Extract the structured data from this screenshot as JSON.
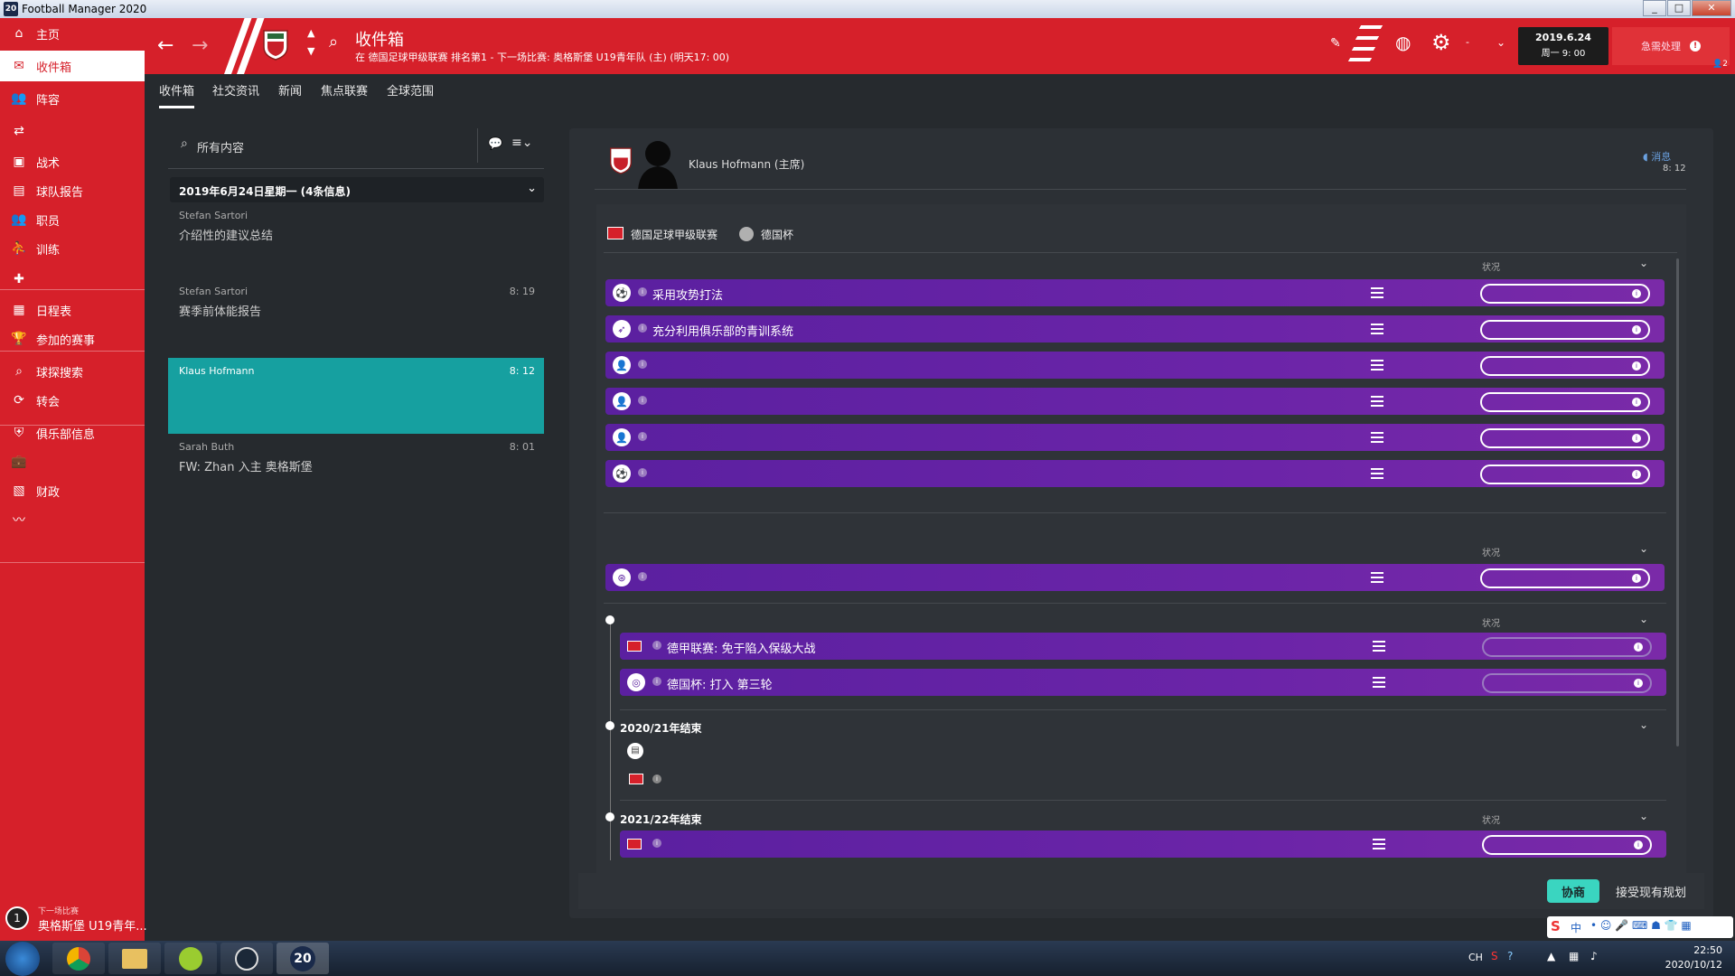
{
  "window": {
    "title": "Football Manager 2020",
    "icon_text": "20"
  },
  "sidebar": {
    "items": [
      {
        "label": "主页",
        "icon": "home-icon"
      },
      {
        "label": "收件箱",
        "icon": "inbox-icon",
        "active": true
      },
      {
        "label": "阵容",
        "icon": "squad-icon"
      },
      {
        "label": "",
        "icon": "dynamics-icon"
      },
      {
        "label": "战术",
        "icon": "tactics-icon"
      },
      {
        "label": "球队报告",
        "icon": "report-icon"
      },
      {
        "label": "职员",
        "icon": "staff-icon"
      },
      {
        "label": "训练",
        "icon": "training-icon"
      },
      {
        "label": "",
        "icon": "medical-icon"
      },
      {
        "label": "日程表",
        "icon": "calendar-icon"
      },
      {
        "label": "参加的赛事",
        "icon": "trophy-icon"
      },
      {
        "label": "球探搜索",
        "icon": "scouting-icon"
      },
      {
        "label": "转会",
        "icon": "transfer-icon"
      },
      {
        "label": "俱乐部信息",
        "icon": "club-icon"
      },
      {
        "label": "",
        "icon": "briefcase-icon"
      },
      {
        "label": "财政",
        "icon": "finance-icon"
      },
      {
        "label": "",
        "icon": "dev-center-icon"
      }
    ],
    "next_match": {
      "label": "下一场比赛",
      "name": "奥格斯堡 U19青年...",
      "cal": "1"
    }
  },
  "header": {
    "title": "收件箱",
    "subtitle": "在 德国足球甲级联赛 排名第1 - 下一场比赛: 奥格斯堡 U19青年队 (主) (明天17: 00)",
    "date": "2019.6.24",
    "day_time": "周一 9: 00",
    "urgent_label": "急需处理",
    "urgent_icon": "!",
    "count_badge": "2",
    "settings_dash": "-"
  },
  "tabs": [
    "收件箱",
    "社交资讯",
    "新闻",
    "焦点联赛",
    "全球范围"
  ],
  "inbox": {
    "search_label": "所有内容",
    "date_group": "2019年6月24日星期一 (4条信息)",
    "messages": [
      {
        "from": "Stefan Sartori",
        "time": "",
        "subject": "介绍性的建议总结"
      },
      {
        "from": "Stefan Sartori",
        "time": "8: 19",
        "subject": "赛季前体能报告"
      },
      {
        "from": "Klaus Hofmann",
        "time": "8: 12",
        "subject": "",
        "selected": true
      },
      {
        "from": "Sarah Buth",
        "time": "8: 01",
        "subject": "FW: Zhan 入主 奥格斯堡"
      }
    ]
  },
  "message": {
    "sender": "Klaus Hofmann (主席)",
    "reply_label": "消息",
    "time": "8: 12",
    "competitions": [
      "德国足球甲级联赛",
      "德国杯"
    ],
    "status_header": "状况",
    "group1_rows": [
      {
        "label": "采用攻势打法",
        "icon": "ball-icon"
      },
      {
        "label": "充分利用俱乐部的青训系统",
        "icon": "youth-icon"
      },
      {
        "label": "",
        "icon": "person-icon"
      },
      {
        "label": "",
        "icon": "person-icon"
      },
      {
        "label": "",
        "icon": "person-icon"
      },
      {
        "label": "",
        "icon": "ball-icon"
      }
    ],
    "group2_rows": [
      {
        "label": "",
        "icon": "money-icon"
      }
    ],
    "group3_rows": [
      {
        "label": "德甲联赛: 免于陷入保级大战",
        "icon": "league-flag-icon"
      },
      {
        "label": "德国杯: 打入 第三轮",
        "icon": "cup-icon"
      }
    ],
    "season1": "2020/21年结束",
    "season2": "2021/22年结束",
    "negotiate_label": "协商",
    "accept_label": "接受现有规划"
  },
  "taskbar": {
    "clock_time": "22:50",
    "clock_date": "2020/10/12",
    "lang": "CH",
    "ime": "中"
  },
  "colors": {
    "brand_red": "#d6202a",
    "row_purple": "#5b20a0",
    "teal": "#16a0a0",
    "accent_green": "#3ad5c0"
  }
}
